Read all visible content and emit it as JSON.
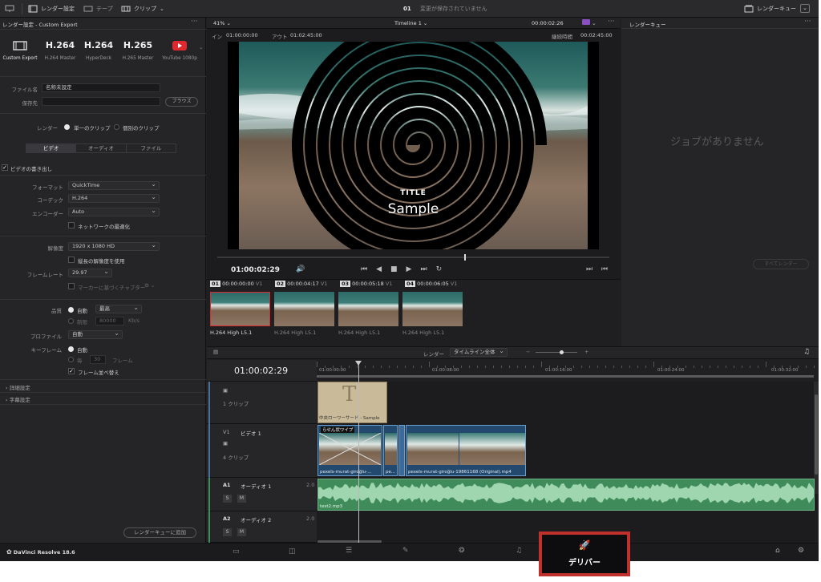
{
  "topbar": {
    "project_settings_label": "レンダー設定",
    "tape_label": "テープ",
    "clip_label": "クリップ",
    "title_num": "01",
    "unsaved": "変更が保存されていません",
    "render_queue_label": "レンダーキュー"
  },
  "left": {
    "header": "レンダー設定 - Custom Export",
    "presets": [
      {
        "big": "",
        "small": "Custom Export"
      },
      {
        "big": "H.264",
        "small": "H.264 Master"
      },
      {
        "big": "H.264",
        "small": "HyperDeck"
      },
      {
        "big": "H.265",
        "small": "H.265 Master"
      },
      {
        "big": "",
        "small": "YouTube 1080p"
      }
    ],
    "filename_label": "ファイル名",
    "filename_value": "名称未設定",
    "saveto_label": "保存先",
    "browse": "ブラウズ",
    "render_label": "レンダー",
    "single_clip": "単一のクリップ",
    "individual_clips": "個別のクリップ",
    "tabs": [
      "ビデオ",
      "オーディオ",
      "ファイル"
    ],
    "export_video": "ビデオの書き出し",
    "format_label": "フォーマット",
    "format_value": "QuickTime",
    "codec_label": "コーデック",
    "codec_value": "H.264",
    "encoder_label": "エンコーダー",
    "encoder_value": "Auto",
    "network_opt": "ネットワークの最適化",
    "resolution_label": "解像度",
    "resolution_value": "1920 x 1080 HD",
    "vertical_res": "縦長の解像度を使用",
    "framerate_label": "フレームレート",
    "framerate_value": "29.97",
    "chapters": "マーカーに基づくチャプター",
    "quality_label": "品質",
    "auto": "自動",
    "quality_value": "最高",
    "restrict": "制限",
    "kbps_value": "80000",
    "kbps_unit": "Kb/s",
    "profile_label": "プロファイル",
    "profile_value": "自動",
    "keyframe_label": "キーフレーム",
    "keyframe_auto": "自動",
    "every": "毎",
    "every_value": "30",
    "frames": "フレーム",
    "reorder": "フレーム並べ替え",
    "advanced": "詳細設定",
    "subtitles": "字幕設定",
    "add_queue": "レンダーキューに追加"
  },
  "viewer": {
    "zoom": "41%",
    "timeline_name": "Timeline 1",
    "timecode_top": "00:00:02:26",
    "in_label": "イン",
    "in_tc": "01:00:00:00",
    "out_label": "アウト",
    "out_tc": "01:02:45:00",
    "duration_label": "継続時間",
    "duration_tc": "00:02:45:00",
    "title_small": "TITLE",
    "title_big": "Sample",
    "current_tc": "01:00:02:29"
  },
  "clips": [
    {
      "num": "01",
      "tc": "00:00:00:00",
      "track": "V1",
      "codec": "H.264 High L5.1"
    },
    {
      "num": "02",
      "tc": "00:00:04:17",
      "track": "V1",
      "codec": "H.264 High L5.1"
    },
    {
      "num": "03",
      "tc": "00:00:05:18",
      "track": "V1",
      "codec": "H.264 High L5.1"
    },
    {
      "num": "04",
      "tc": "00:00:06:05",
      "track": "V1",
      "codec": "H.264 High L5.1"
    }
  ],
  "queue": {
    "title": "レンダーキュー",
    "empty": "ジョブがありません",
    "render_all": "すべてレンダー"
  },
  "timeline": {
    "render_label": "レンダー",
    "render_value": "タイムライン全体",
    "tc": "01:00:02:29",
    "ruler": [
      "01:00:00:00",
      "01:00:08:00",
      "01:00:16:00",
      "01:00:24:00",
      "01:00:32:00"
    ],
    "track_title_clips": "1 クリップ",
    "v1": "V1",
    "v1_name": "ビデオ 1",
    "v1_clips": "4 クリップ",
    "a1": "A1",
    "a1_name": "オーディオ 1",
    "a1_vol": "2.0",
    "a2": "A2",
    "a2_name": "オーディオ 2",
    "a2_vol": "2.0",
    "title_clip": "中央ローワーサード - Sample",
    "spiral_clip": "らせん状ワイプ",
    "clip1_name": "pexels-murat-gi̇roğlu-...",
    "clip2_name": "pe...",
    "clip3_name": "pexels-murat-gi̇roğlu-19861168 (Original).mp4",
    "audio_clip": "test2.mp3"
  },
  "bottom": {
    "app_name": "DaVinci Resolve 18.6",
    "deliver": "デリバー"
  },
  "colors": {
    "accent": "#e0292f",
    "clip_blue": "#6aa0d0",
    "audio_green": "#3f8c5a"
  }
}
